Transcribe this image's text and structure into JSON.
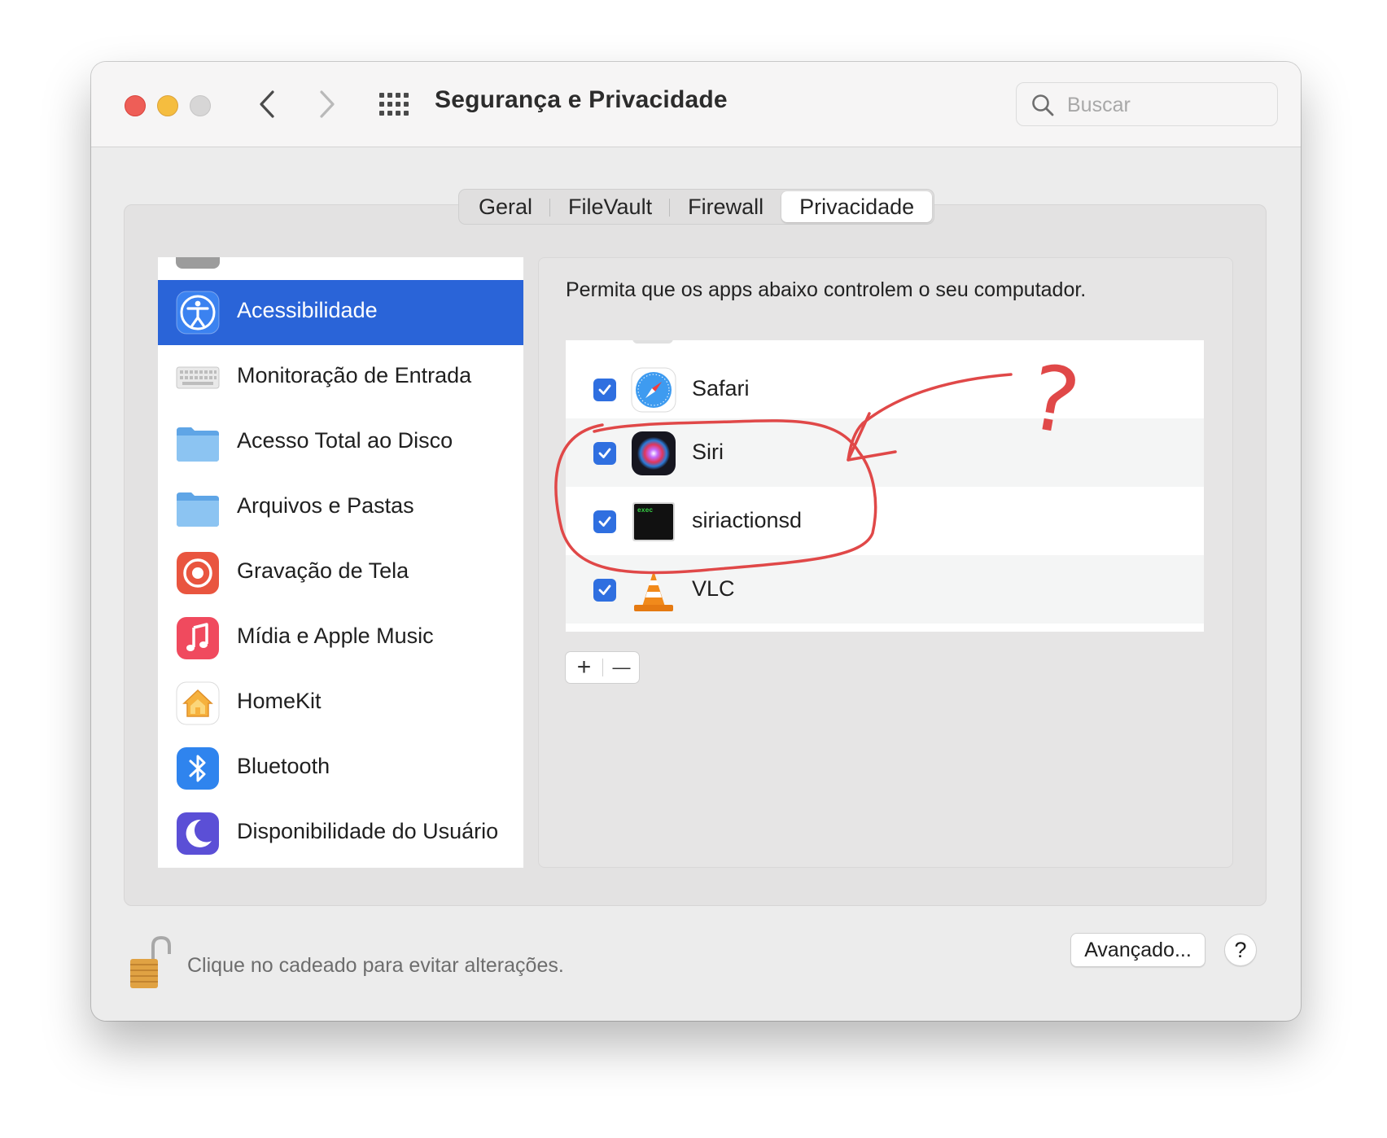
{
  "window": {
    "title": "Segurança e Privacidade",
    "search_placeholder": "Buscar"
  },
  "tabs": [
    {
      "label": "Geral",
      "active": false
    },
    {
      "label": "FileVault",
      "active": false
    },
    {
      "label": "Firewall",
      "active": false
    },
    {
      "label": "Privacidade",
      "active": true
    }
  ],
  "sidebar": {
    "items": [
      {
        "label": "Acessibilidade",
        "icon": "accessibility-icon",
        "selected": true
      },
      {
        "label": "Monitoração de Entrada",
        "icon": "keyboard-icon",
        "selected": false
      },
      {
        "label": "Acesso Total ao Disco",
        "icon": "folder-icon",
        "selected": false
      },
      {
        "label": "Arquivos e Pastas",
        "icon": "folder-icon",
        "selected": false
      },
      {
        "label": "Gravação de Tela",
        "icon": "screen-record-icon",
        "selected": false
      },
      {
        "label": "Mídia e Apple Music",
        "icon": "music-icon",
        "selected": false
      },
      {
        "label": "HomeKit",
        "icon": "home-icon",
        "selected": false
      },
      {
        "label": "Bluetooth",
        "icon": "bluetooth-icon",
        "selected": false
      },
      {
        "label": "Disponibilidade do Usuário",
        "icon": "moon-icon",
        "selected": false
      }
    ]
  },
  "main": {
    "description": "Permita que os apps abaixo controlem o seu computador.",
    "apps": [
      {
        "name": "Safari",
        "checked": true,
        "icon": "safari-icon"
      },
      {
        "name": "Siri",
        "checked": true,
        "icon": "siri-icon"
      },
      {
        "name": "siriactionsd",
        "checked": true,
        "icon": "exec-terminal-icon",
        "icon_text": "exec"
      },
      {
        "name": "VLC",
        "checked": true,
        "icon": "vlc-cone-icon"
      }
    ],
    "add_label": "+",
    "remove_label": "—"
  },
  "footer": {
    "lock_text": "Clique no cadeado para evitar alterações.",
    "advanced_label": "Avançado...",
    "help_label": "?"
  },
  "annotation": {
    "mark": "?",
    "color": "#e04848"
  },
  "colors": {
    "selection_blue": "#2a64d8",
    "checkbox_blue": "#2f6fe0"
  }
}
